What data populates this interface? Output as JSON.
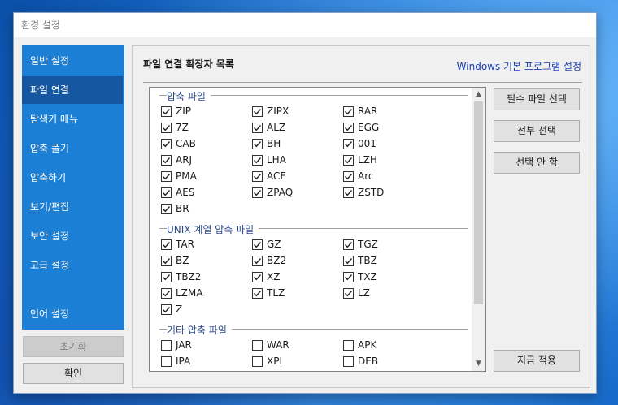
{
  "window": {
    "title": "환경 설정"
  },
  "sidebar": {
    "items": [
      {
        "label": "일반 설정"
      },
      {
        "label": "파일 연결",
        "active": true
      },
      {
        "label": "탐색기 메뉴"
      },
      {
        "label": "압축 풀기"
      },
      {
        "label": "압축하기"
      },
      {
        "label": "보기/편집"
      },
      {
        "label": "보안 설정"
      },
      {
        "label": "고급 설정"
      },
      {
        "label": "언어 설정"
      }
    ],
    "reset_label": "초기화",
    "ok_label": "확인"
  },
  "content": {
    "title": "파일 연결 확장자 목록",
    "default_programs_link": "Windows 기본 프로그램 설정",
    "buttons": {
      "required": "필수 파일 선택",
      "select_all": "전부 선택",
      "select_none": "선택 안 함",
      "apply_now": "지금 적용"
    },
    "groups": [
      {
        "label": "압축 파일",
        "items": [
          {
            "ext": "ZIP",
            "checked": true
          },
          {
            "ext": "ZIPX",
            "checked": true
          },
          {
            "ext": "RAR",
            "checked": true
          },
          {
            "ext": "7Z",
            "checked": true
          },
          {
            "ext": "ALZ",
            "checked": true
          },
          {
            "ext": "EGG",
            "checked": true
          },
          {
            "ext": "CAB",
            "checked": true
          },
          {
            "ext": "BH",
            "checked": true
          },
          {
            "ext": "001",
            "checked": true
          },
          {
            "ext": "ARJ",
            "checked": true
          },
          {
            "ext": "LHA",
            "checked": true
          },
          {
            "ext": "LZH",
            "checked": true
          },
          {
            "ext": "PMA",
            "checked": true
          },
          {
            "ext": "ACE",
            "checked": true
          },
          {
            "ext": "Arc",
            "checked": true
          },
          {
            "ext": "AES",
            "checked": true
          },
          {
            "ext": "ZPAQ",
            "checked": true
          },
          {
            "ext": "ZSTD",
            "checked": true
          },
          {
            "ext": "BR",
            "checked": true
          }
        ]
      },
      {
        "label": "UNIX 계열 압축 파일",
        "items": [
          {
            "ext": "TAR",
            "checked": true
          },
          {
            "ext": "GZ",
            "checked": true
          },
          {
            "ext": "TGZ",
            "checked": true
          },
          {
            "ext": "BZ",
            "checked": true
          },
          {
            "ext": "BZ2",
            "checked": true
          },
          {
            "ext": "TBZ",
            "checked": true
          },
          {
            "ext": "TBZ2",
            "checked": true
          },
          {
            "ext": "XZ",
            "checked": true
          },
          {
            "ext": "TXZ",
            "checked": true
          },
          {
            "ext": "LZMA",
            "checked": true
          },
          {
            "ext": "TLZ",
            "checked": true
          },
          {
            "ext": "LZ",
            "checked": true
          },
          {
            "ext": "Z",
            "checked": true
          }
        ]
      },
      {
        "label": "기타 압축 파일",
        "items": [
          {
            "ext": "JAR",
            "checked": false
          },
          {
            "ext": "WAR",
            "checked": false
          },
          {
            "ext": "APK",
            "checked": false
          },
          {
            "ext": "IPA",
            "checked": false
          },
          {
            "ext": "XPI",
            "checked": false
          },
          {
            "ext": "DEB",
            "checked": false
          }
        ]
      }
    ]
  },
  "colors": {
    "sidebar_bg": "#1b7fd6",
    "sidebar_active": "#1557a1",
    "link": "#1a3fb5",
    "group_label": "#2e4a8f"
  }
}
